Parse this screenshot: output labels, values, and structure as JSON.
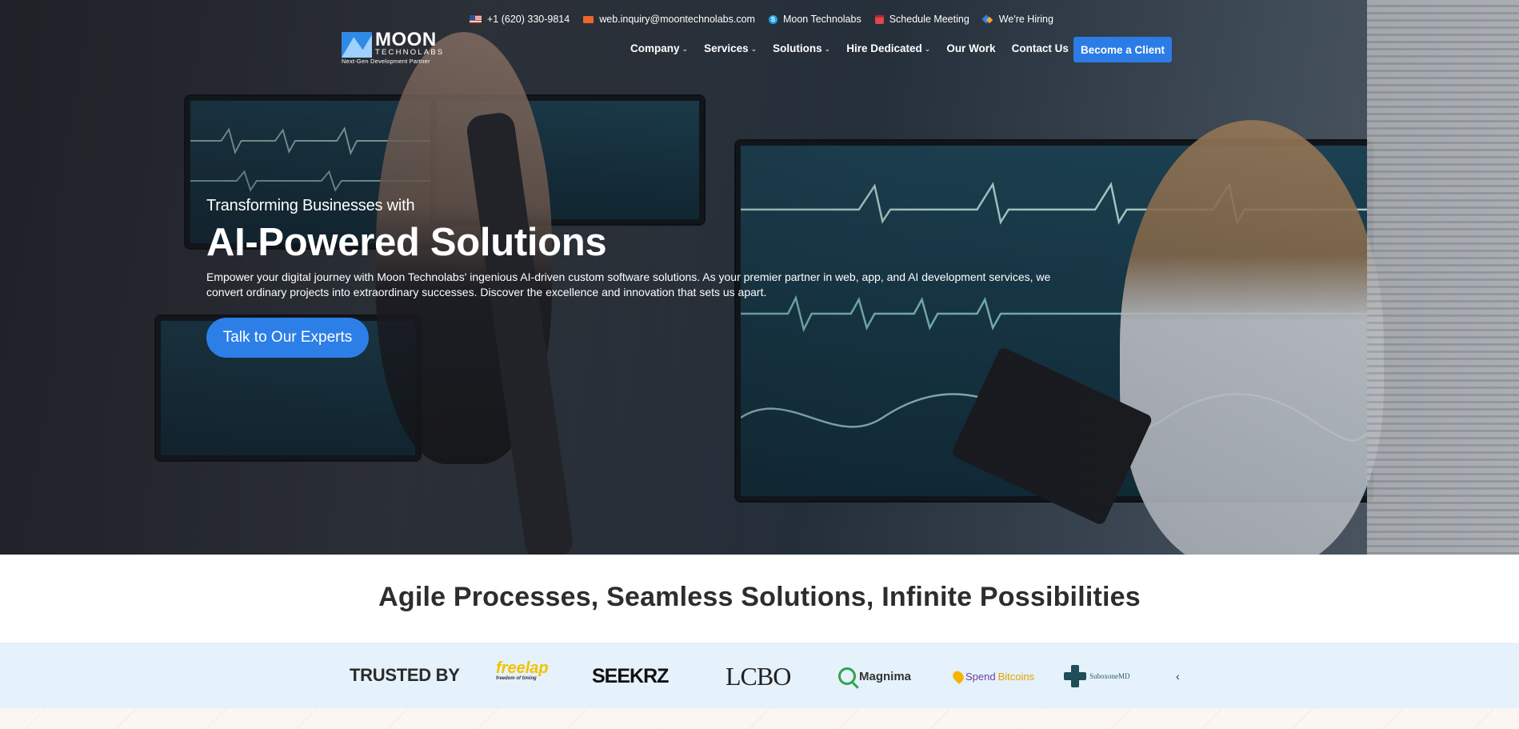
{
  "utility": {
    "phone": "+1 (620) 330-9814",
    "email": "web.inquiry@moontechnolabs.com",
    "skype": "Moon Technolabs",
    "schedule": "Schedule Meeting",
    "hiring": "We're Hiring"
  },
  "logo": {
    "name": "MOON",
    "sub": "TECHNOLABS",
    "tagline": "Next-Gen Development Partner"
  },
  "nav": {
    "items": [
      {
        "label": "Company",
        "dropdown": true
      },
      {
        "label": "Services",
        "dropdown": true
      },
      {
        "label": "Solutions",
        "dropdown": true
      },
      {
        "label": "Hire Dedicated",
        "dropdown": true
      },
      {
        "label": "Our Work",
        "dropdown": false
      },
      {
        "label": "Contact Us",
        "dropdown": false
      }
    ],
    "chevron": "⌄",
    "cta": "Become a Client"
  },
  "hero": {
    "pre_title": "Transforming Businesses with",
    "title": "AI-Powered Solutions",
    "description": "Empower your digital journey with Moon Technolabs' ingenious AI-driven custom software solutions. As your premier partner in web, app, and AI development services, we convert ordinary projects into extraordinary successes. Discover the excellence and innovation that sets us apart.",
    "button": "Talk to Our Experts"
  },
  "agile_heading": "Agile Processes, Seamless Solutions, Infinite Possibilities",
  "trusted": {
    "label": "TRUSTED BY",
    "brands": {
      "freelap": "freelap",
      "freelap_tag": "freedom of timing",
      "seekerz": "SEEKRZ",
      "lcbo": "LCBO",
      "magnima": "Magnima",
      "spend_a": "Spend",
      "spend_b": "Bitcoins",
      "suboxone": "SuboxoneMD"
    }
  },
  "colors": {
    "accent": "#2b7de5",
    "trusted_bg": "#e5f1fb",
    "heading": "#2d2d2d"
  }
}
